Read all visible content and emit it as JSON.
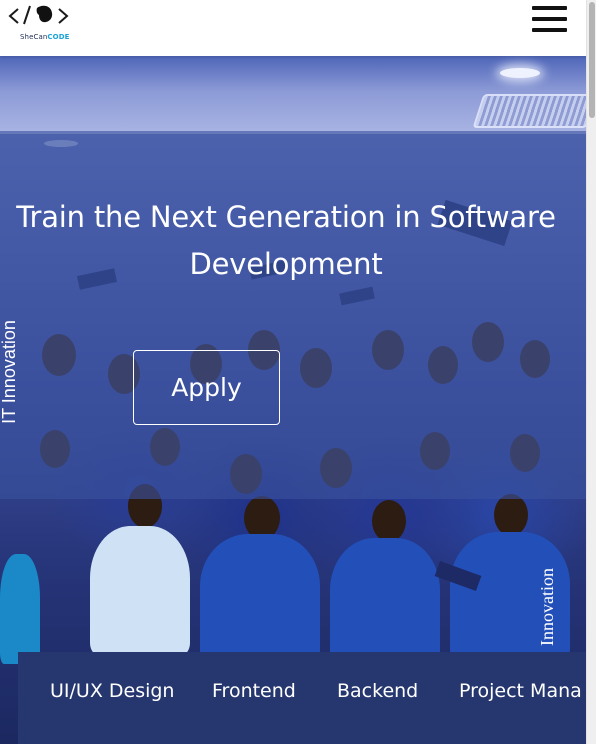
{
  "header": {
    "logo_prefix": "SheCan",
    "logo_highlight": "CODE",
    "menu_icon": "hamburger-menu-icon"
  },
  "hero": {
    "headline": "Train the Next Generation in Software Development",
    "apply_label": "Apply",
    "vertical_left": "IT Innovation",
    "vertical_right": "Innovation"
  },
  "tabs": [
    "UI/UX Design",
    "Frontend",
    "Backend",
    "Project Mana"
  ],
  "colors": {
    "header_bg": "#ffffff",
    "overlay": "#3a529e",
    "tabs_bg": "#25376e",
    "logo_dark": "#1f2e57",
    "logo_accent": "#1aa3d9"
  }
}
